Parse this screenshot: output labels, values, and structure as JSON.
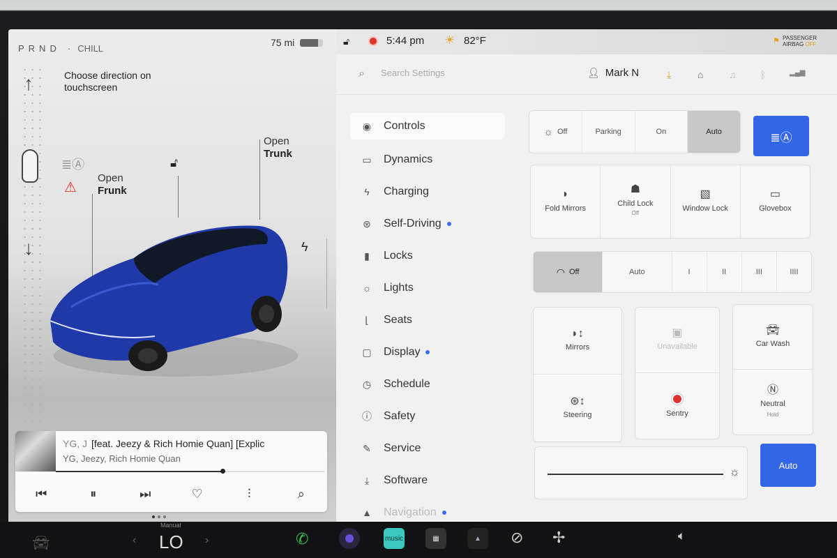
{
  "status": {
    "gear": "PRND",
    "drive_mode": "CHILL",
    "range": "75 mi",
    "battery_level": 0.78,
    "time": "5:44 pm",
    "temperature": "82°F",
    "airbag_line1": "PASSENGER",
    "airbag_line2": "AIRBAG",
    "airbag_state": "OFF"
  },
  "car": {
    "direction_hint": "Choose direction on touchscreen",
    "frunk_action": "Open",
    "frunk_label": "Frunk",
    "trunk_action": "Open",
    "trunk_label": "Trunk"
  },
  "media": {
    "title": "[feat. Jeezy & Rich Homie Quan] [Explic",
    "title_prefix": "YG, J",
    "artist": "YG, Jeezy, Rich Homie Quan",
    "progress": 0.62
  },
  "header": {
    "search_placeholder": "Search Settings",
    "user_name": "Mark N"
  },
  "nav": [
    {
      "label": "Controls",
      "icon": "toggle-icon",
      "active": true
    },
    {
      "label": "Dynamics",
      "icon": "car-icon"
    },
    {
      "label": "Charging",
      "icon": "bolt-icon"
    },
    {
      "label": "Self-Driving",
      "icon": "steering-wheel-icon",
      "badge": true
    },
    {
      "label": "Locks",
      "icon": "lock-icon"
    },
    {
      "label": "Lights",
      "icon": "light-icon"
    },
    {
      "label": "Seats",
      "icon": "seat-icon"
    },
    {
      "label": "Display",
      "icon": "display-icon",
      "badge": true
    },
    {
      "label": "Schedule",
      "icon": "clock-icon"
    },
    {
      "label": "Safety",
      "icon": "safety-icon"
    },
    {
      "label": "Service",
      "icon": "wrench-icon"
    },
    {
      "label": "Software",
      "icon": "download-icon"
    },
    {
      "label": "Navigation",
      "icon": "navigation-icon",
      "badge": true
    }
  ],
  "headlights": {
    "options": [
      "Off",
      "Parking",
      "On",
      "Auto"
    ],
    "selected": "Auto"
  },
  "quick_tiles": [
    {
      "label": "Fold Mirrors",
      "sub": ""
    },
    {
      "label": "Child Lock",
      "sub": "Off"
    },
    {
      "label": "Window Lock",
      "sub": ""
    },
    {
      "label": "Glovebox",
      "sub": ""
    }
  ],
  "wipers": {
    "options": [
      "Off",
      "Auto",
      "I",
      "II",
      "III",
      "IIII"
    ],
    "selected": "Off"
  },
  "cards": {
    "mirrors": "Mirrors",
    "steering": "Steering",
    "unavailable": "Unavailable",
    "sentry": "Sentry",
    "car_wash": "Car Wash",
    "neutral": "Neutral",
    "neutral_sub": "Hold"
  },
  "brightness": {
    "auto_label": "Auto"
  },
  "taskbar": {
    "climate_mode": "Manual",
    "climate_temp": "LO",
    "music_app": "music"
  },
  "colors": {
    "accent": "#3366e6",
    "alert": "#e0332c",
    "car_paint": "#1f3aa8"
  }
}
